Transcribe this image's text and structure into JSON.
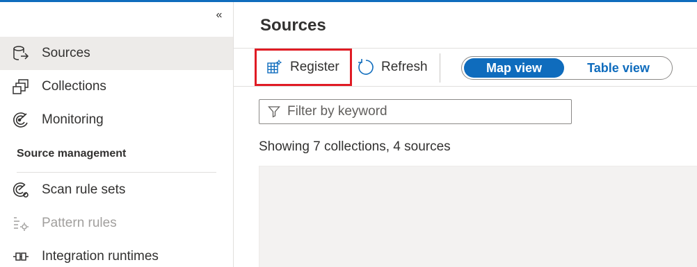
{
  "sidebar": {
    "collapse_glyph": "«",
    "items": [
      {
        "label": "Sources",
        "icon": "database-arrow-icon",
        "selected": true
      },
      {
        "label": "Collections",
        "icon": "collections-icon"
      },
      {
        "label": "Monitoring",
        "icon": "monitoring-icon"
      }
    ],
    "section_header": "Source management",
    "management_items": [
      {
        "label": "Scan rule sets",
        "icon": "scan-rule-icon"
      },
      {
        "label": "Pattern rules",
        "icon": "pattern-rules-icon",
        "disabled": true
      },
      {
        "label": "Integration runtimes",
        "icon": "integration-runtime-icon"
      }
    ]
  },
  "main": {
    "title": "Sources",
    "toolbar": {
      "register_label": "Register",
      "refresh_label": "Refresh"
    },
    "view_toggle": {
      "options": [
        "Map view",
        "Table view"
      ],
      "selected": "Map view"
    },
    "filter": {
      "placeholder": "Filter by keyword"
    },
    "summary": "Showing 7 collections, 4 sources"
  },
  "colors": {
    "accent": "#0f6cbd",
    "highlight_border": "#e01b24",
    "selected_bg": "#edebe9",
    "canvas_bg": "#f3f2f1"
  }
}
